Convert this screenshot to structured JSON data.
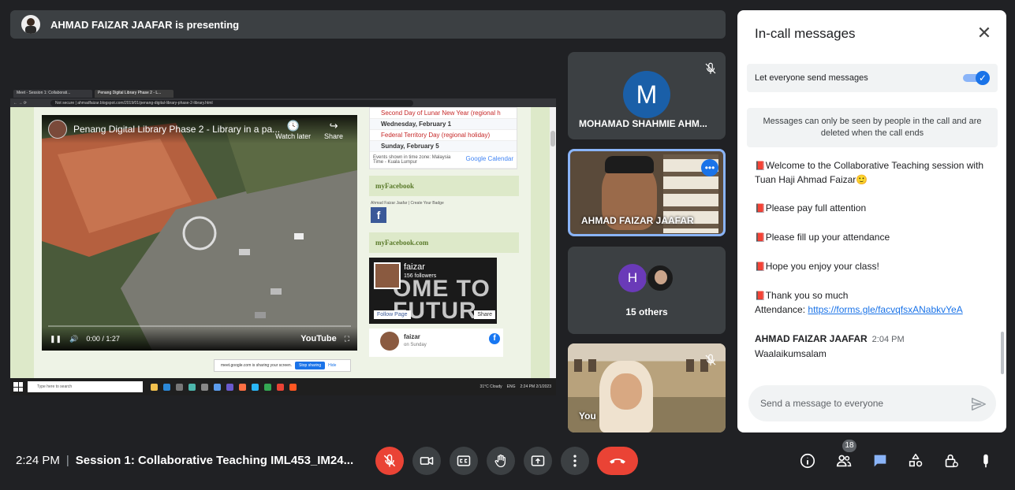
{
  "banner": {
    "text": "AHMAD FAIZAR JAAFAR is presenting"
  },
  "screen": {
    "tabs": [
      "Meet - Session 1: Collaborati...",
      "Penang Digital Library Phase 2 - L..."
    ],
    "address": "Not secure | ahmadfaizar.blogspot.com/2019/01/penang-digital-library-phase-2-library.html",
    "video": {
      "title": "Penang Digital Library Phase 2 - Library in a pa...",
      "watch_later": "Watch later",
      "share": "Share",
      "time": "0:00 / 1:27",
      "brand": "YouTube"
    },
    "calendar": {
      "rows": [
        {
          "text": "Second Day of Lunar New Year (regional h",
          "style": "red"
        },
        {
          "text": "Wednesday, February 1",
          "style": "bold"
        },
        {
          "text": "Federal Territory Day (regional holiday)",
          "style": "red"
        },
        {
          "text": "Sunday, February 5",
          "style": "bold"
        }
      ],
      "footer_left": "Events shown in time zone: Malaysia Time - Kuala Lumpur",
      "footer_logo": "Google Calendar"
    },
    "widgets": {
      "my_facebook": "myFacebook",
      "badge_line": "Ahmad Faizar Jaafar | Create Your Badge",
      "my_facebook_com": "myFacebook.com",
      "fb_name": "faizar",
      "fb_followers": "156 followers",
      "fb_cover_text": "OME TO FUTUR",
      "fb_follow": "Follow Page",
      "fb_share": "Share",
      "post_name": "faizar",
      "post_date": "on Sunday"
    },
    "sharebar": {
      "text": "meet.google.com is sharing your screen.",
      "stop": "Stop sharing",
      "hide": "Hide"
    },
    "taskbar": {
      "search": "Type here to search",
      "weather": "31°C Cloudy",
      "lang": "ENG",
      "clock_time": "2:24 PM",
      "clock_date": "2/1/2023"
    }
  },
  "participants": {
    "p1_initial": "M",
    "p1_name": "MOHAMAD SHAHMIE AHM...",
    "p2_name": "AHMAD FAIZAR JAAFAR",
    "p3_initial": "H",
    "p3_count": "15 others",
    "p4_name": "You"
  },
  "panel": {
    "title": "In-call messages",
    "toggle_label": "Let everyone send messages",
    "notice": "Messages can only be seen by people in the call and are deleted when the call ends",
    "messages": [
      "Welcome to the Collaborative Teaching  session with Tuan Haji Ahmad Faizar🙂",
      "Please pay full attention",
      "Please fill up your attendance",
      "Hope you enjoy your class!",
      "Thank you so much"
    ],
    "attendance_label": "Attendance: ",
    "attendance_link": "https://forms.gle/facvqfsxANabkvYeA",
    "sender": "AHMAD FAIZAR JAAFAR",
    "sender_time": "2:04 PM",
    "reply": "Waalaikumsalam",
    "input_placeholder": "Send a message to everyone"
  },
  "bottom": {
    "time": "2:24 PM",
    "separator": "|",
    "meeting": "Session 1: Collaborative Teaching IML453_IM24...",
    "people_count": "18"
  },
  "colors": {
    "accent": "#1a73e8",
    "danger": "#ea4335",
    "surface": "#3c4043",
    "background": "#202124"
  }
}
